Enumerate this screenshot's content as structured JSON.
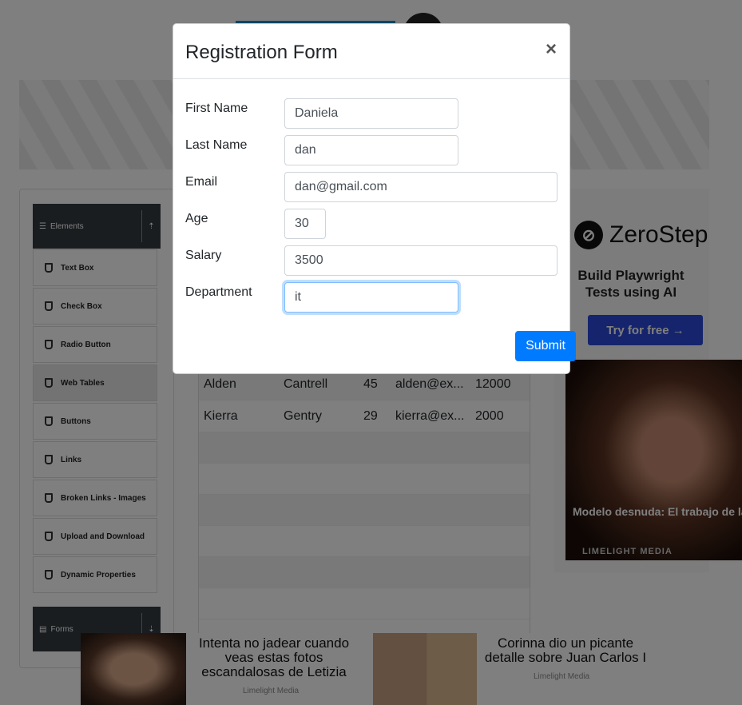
{
  "modal": {
    "title": "Registration Form",
    "close_label": "×",
    "fields": [
      {
        "label": "First Name",
        "value": "Daniela"
      },
      {
        "label": "Last Name",
        "value": "dan"
      },
      {
        "label": "Email",
        "value": "dan@gmail.com"
      },
      {
        "label": "Age",
        "value": "30"
      },
      {
        "label": "Salary",
        "value": "3500"
      },
      {
        "label": "Department",
        "value": "it"
      }
    ],
    "submit_label": "Submit"
  },
  "sidebar": {
    "elements_header": "Elements",
    "forms_header": "Forms",
    "items": [
      {
        "label": "Text Box"
      },
      {
        "label": "Check Box"
      },
      {
        "label": "Radio Button"
      },
      {
        "label": "Web Tables"
      },
      {
        "label": "Buttons"
      },
      {
        "label": "Links"
      },
      {
        "label": "Broken Links - Images"
      },
      {
        "label": "Upload and Download"
      },
      {
        "label": "Dynamic Properties"
      }
    ]
  },
  "table": {
    "rows": [
      [
        "Alden",
        "Cantrell",
        "45",
        "alden@ex...",
        "12000"
      ],
      [
        "Kierra",
        "Gentry",
        "29",
        "kierra@ex...",
        "2000"
      ]
    ]
  },
  "ads": {
    "zerostep_name": "ZeroStep",
    "zerostep_tagline": "Build Playwright Tests using AI",
    "zerostep_cta": "Try for free →",
    "photo_caption": "Modelo desnuda: El trabajo de la Letizia antes de ser reina",
    "photo_brand": "LIMELIGHT MEDIA",
    "bottom_text1": "Intenta no jadear cuando veas estas fotos escandalosas de Letizia",
    "bottom_brand1": "Limelight Media",
    "bottom_text2": "Corinna dio un picante detalle sobre Juan Carlos I",
    "bottom_brand2": "Limelight Media"
  }
}
